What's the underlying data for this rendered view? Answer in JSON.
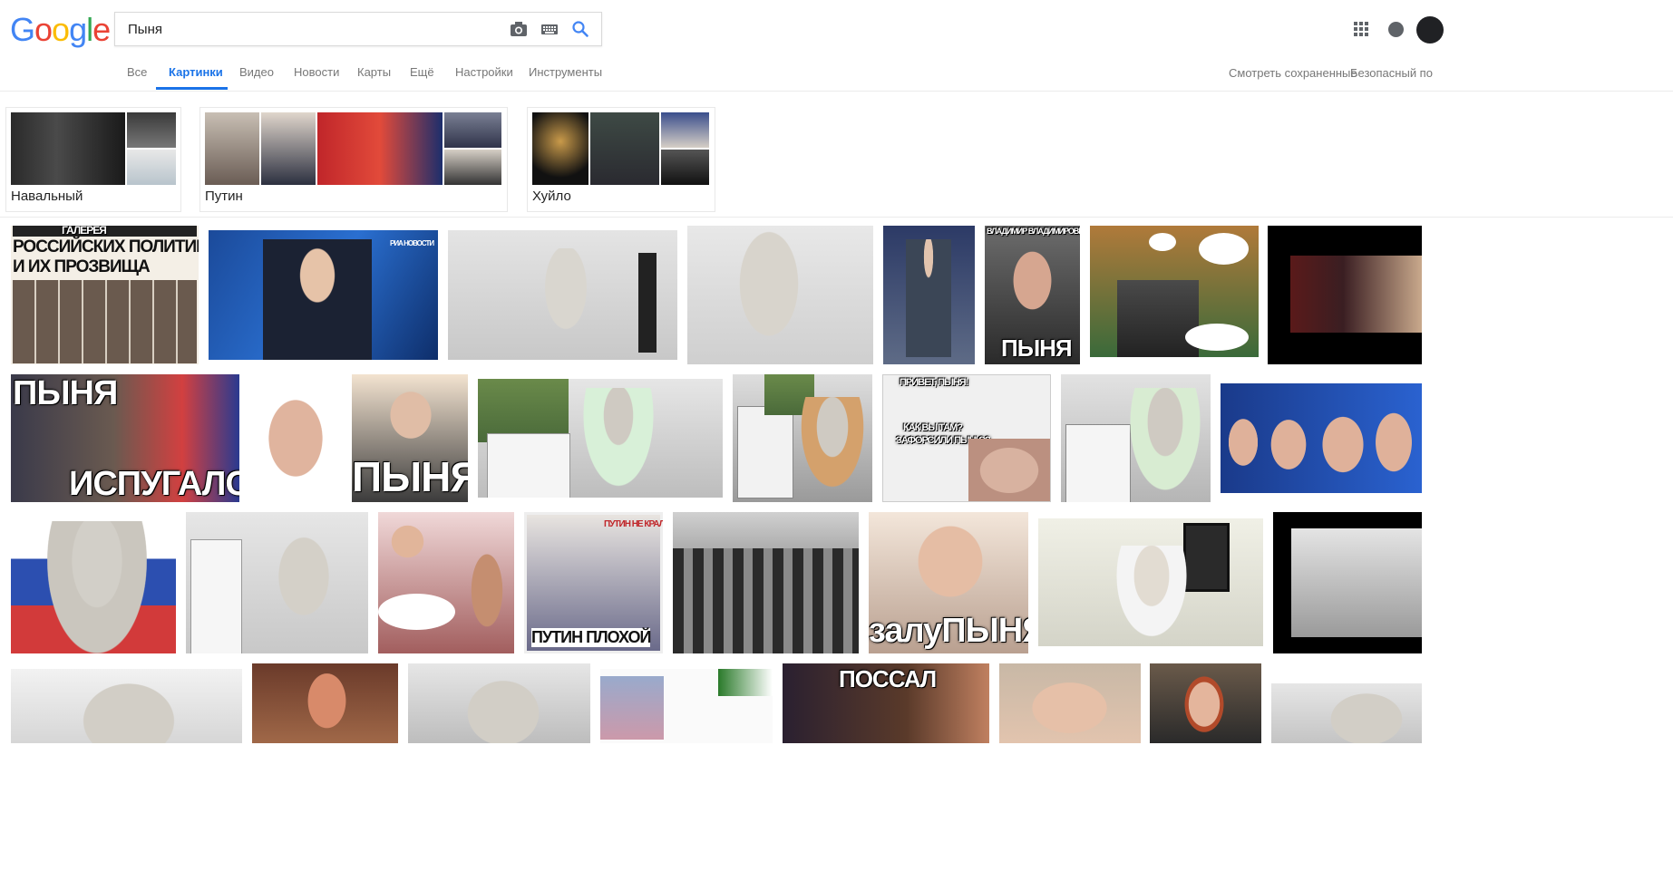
{
  "logo": [
    "G",
    "o",
    "o",
    "g",
    "l",
    "e"
  ],
  "search": {
    "value": "Пыня"
  },
  "tabs": [
    "Все",
    "Картинки",
    "Видео",
    "Новости",
    "Карты",
    "Ещё",
    "Настройки",
    "Инструменты"
  ],
  "right_links": {
    "saved": "Смотреть сохраненные",
    "safe": "Безопасный по"
  },
  "chips": [
    {
      "label": "Навальный"
    },
    {
      "label": "Путин"
    },
    {
      "label": "Хуйло"
    }
  ],
  "tiles": {
    "r1_t1": "ГАЛЕРЕЯ",
    "r1_t1b": "РОССИЙСКИХ ПОЛИТИКОВ",
    "r1_t1c": "И ИХ ПРОЗВИЩА",
    "r1_t2": "РИА НОВОСТИ",
    "r1_t6a": "ВЛАДИМИР ВЛАДИМИРОВИЧ",
    "r1_t6b": "ПЫНЯ",
    "r2_t1a": "ПЫНЯ",
    "r2_t1b": "ИСПУГАЛСЯ",
    "r2_t3": "ПЫНЯ",
    "r2_t6a": "ПРИВЕТ, ПЫНЯ!",
    "r2_t6b": "КАК ВЫ ТАМ?",
    "r2_t6c": "ЗАФОРСИЛИ ПЫНЮ?",
    "r3_t4a": "ПУТИН НЕ КРАЛ ЛЕС !",
    "r3_t4b": "ПУТИН ПЛОХОЙ",
    "r3_t7": "залуПЫНЯ",
    "r4_t5": "ПОССАЛ"
  }
}
